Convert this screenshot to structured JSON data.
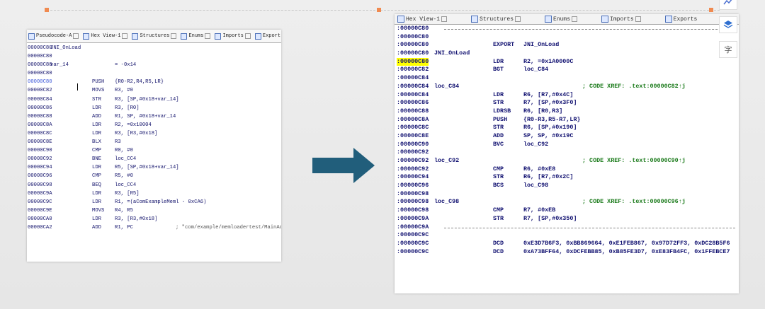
{
  "left": {
    "tabs": [
      "Pseudocode-A",
      "Hex View-1",
      "Structures",
      "Enums",
      "Imports",
      "Export"
    ],
    "lines": [
      {
        "addr": "00000C80",
        "label": "JNI_OnLoad",
        "mn": "",
        "op": "",
        "cm": ""
      },
      {
        "addr": "00000C80",
        "label": "",
        "mn": "",
        "op": "",
        "cm": ""
      },
      {
        "addr": "00000C80",
        "label": "var_14",
        "mn": "",
        "op": "= -0x14",
        "cm": ""
      },
      {
        "addr": "00000C80",
        "label": "",
        "mn": "",
        "op": "",
        "cm": ""
      },
      {
        "addr": "00000C80",
        "label": "",
        "mn": "PUSH",
        "op": "{R0-R2,R4,R5,LR}",
        "cm": "",
        "hl": true
      },
      {
        "addr": "00000C82",
        "label": "",
        "mn": "MOVS",
        "op": "R3, #0",
        "cm": ""
      },
      {
        "addr": "00000C84",
        "label": "",
        "mn": "STR",
        "op": "R3, [SP,#0x18+var_14]",
        "cm": ""
      },
      {
        "addr": "00000C86",
        "label": "",
        "mn": "LDR",
        "op": "R3, [R0]",
        "cm": ""
      },
      {
        "addr": "00000C88",
        "label": "",
        "mn": "ADD",
        "op": "R1, SP, #0x18+var_14",
        "cm": ""
      },
      {
        "addr": "00000C8A",
        "label": "",
        "mn": "LDR",
        "op": "R2, =0x10004",
        "cm": ""
      },
      {
        "addr": "00000C8C",
        "label": "",
        "mn": "LDR",
        "op": "R3, [R3,#0x18]",
        "cm": ""
      },
      {
        "addr": "00000C8E",
        "label": "",
        "mn": "BLX",
        "op": "R3",
        "cm": ""
      },
      {
        "addr": "00000C90",
        "label": "",
        "mn": "CMP",
        "op": "R0, #0",
        "cm": ""
      },
      {
        "addr": "00000C92",
        "label": "",
        "mn": "BNE",
        "op": "loc_CC4",
        "cm": ""
      },
      {
        "addr": "00000C94",
        "label": "",
        "mn": "LDR",
        "op": "R5, [SP,#0x18+var_14]",
        "cm": ""
      },
      {
        "addr": "00000C96",
        "label": "",
        "mn": "CMP",
        "op": "R5, #0",
        "cm": ""
      },
      {
        "addr": "00000C98",
        "label": "",
        "mn": "BEQ",
        "op": "loc_CC4",
        "cm": ""
      },
      {
        "addr": "00000C9A",
        "label": "",
        "mn": "LDR",
        "op": "R3, [R5]",
        "cm": ""
      },
      {
        "addr": "00000C9C",
        "label": "",
        "mn": "LDR",
        "op": "R1, =(aComExampleMeml - 0xCA6)",
        "cm": ""
      },
      {
        "addr": "00000C9E",
        "label": "",
        "mn": "MOVS",
        "op": "R4, R5",
        "cm": ""
      },
      {
        "addr": "00000CA0",
        "label": "",
        "mn": "LDR",
        "op": "R3, [R3,#0x18]",
        "cm": ""
      },
      {
        "addr": "00000CA2",
        "label": "",
        "mn": "ADD",
        "op": "R1, PC",
        "cm": "; \"com/example/memloadertest/MainActivity\""
      }
    ]
  },
  "right": {
    "tabs": [
      "Hex View-1",
      "Structures",
      "Enums",
      "Imports",
      "Exports"
    ],
    "lines": [
      {
        "addr": ":00000C80",
        "label": "",
        "mn": "",
        "op": "",
        "cm": "",
        "sep": true
      },
      {
        "addr": ":00000C80",
        "label": "",
        "mn": "",
        "op": "",
        "cm": ""
      },
      {
        "addr": ":00000C80",
        "label": "",
        "mn": "EXPORT",
        "op": "JNI_OnLoad",
        "cm": ""
      },
      {
        "addr": ":00000C80",
        "label": "JNI_OnLoad",
        "mn": "",
        "op": "",
        "cm": ""
      },
      {
        "addr": ":00000C80",
        "label": "",
        "mn": "LDR",
        "op": "R2, =0x1A0000C",
        "cm": "",
        "hl": true
      },
      {
        "addr": ":00000C82",
        "label": "",
        "mn": "BGT",
        "op": "loc_C84",
        "cm": ""
      },
      {
        "addr": ":00000C84",
        "label": "",
        "mn": "",
        "op": "",
        "cm": ""
      },
      {
        "addr": ":00000C84",
        "label": "loc_C84",
        "mn": "",
        "op": "",
        "cm": "; CODE XREF: .text:00000C82↑j"
      },
      {
        "addr": ":00000C84",
        "label": "",
        "mn": "LDR",
        "op": "R6, [R7,#0x4C]",
        "cm": ""
      },
      {
        "addr": ":00000C86",
        "label": "",
        "mn": "STR",
        "op": "R7, [SP,#0x3F0]",
        "cm": ""
      },
      {
        "addr": ":00000C88",
        "label": "",
        "mn": "LDRSB",
        "op": "R6, [R0,R3]",
        "cm": ""
      },
      {
        "addr": ":00000C8A",
        "label": "",
        "mn": "PUSH",
        "op": "{R0-R3,R5-R7,LR}",
        "cm": ""
      },
      {
        "addr": ":00000C8C",
        "label": "",
        "mn": "STR",
        "op": "R6, [SP,#0x190]",
        "cm": ""
      },
      {
        "addr": ":00000C8E",
        "label": "",
        "mn": "ADD",
        "op": "SP, SP, #0x19C",
        "cm": ""
      },
      {
        "addr": ":00000C90",
        "label": "",
        "mn": "BVC",
        "op": "loc_C92",
        "cm": ""
      },
      {
        "addr": ":00000C92",
        "label": "",
        "mn": "",
        "op": "",
        "cm": ""
      },
      {
        "addr": ":00000C92",
        "label": "loc_C92",
        "mn": "",
        "op": "",
        "cm": "; CODE XREF: .text:00000C90↑j"
      },
      {
        "addr": ":00000C92",
        "label": "",
        "mn": "CMP",
        "op": "R6, #0xE8",
        "cm": ""
      },
      {
        "addr": ":00000C94",
        "label": "",
        "mn": "STR",
        "op": "R6, [R7,#0x2C]",
        "cm": ""
      },
      {
        "addr": ":00000C96",
        "label": "",
        "mn": "BCS",
        "op": "loc_C98",
        "cm": ""
      },
      {
        "addr": ":00000C98",
        "label": "",
        "mn": "",
        "op": "",
        "cm": ""
      },
      {
        "addr": ":00000C98",
        "label": "loc_C98",
        "mn": "",
        "op": "",
        "cm": "; CODE XREF: .text:00000C96↑j"
      },
      {
        "addr": ":00000C98",
        "label": "",
        "mn": "CMP",
        "op": "R7, #0xEB",
        "cm": ""
      },
      {
        "addr": ":00000C9A",
        "label": "",
        "mn": "STR",
        "op": "R7, [SP,#0x350]",
        "cm": ""
      },
      {
        "addr": ":00000C9A",
        "label": "",
        "mn": "",
        "op": "",
        "cm": "",
        "sep": true
      },
      {
        "addr": ":00000C9C",
        "label": "",
        "mn": "",
        "op": "",
        "cm": ""
      },
      {
        "addr": ":00000C9C",
        "label": "",
        "mn": "DCD",
        "op": "0xE3D7B6F3, 0xBB869664, 0xE1FEB867, 0x97D72FF3, 0xDC28B5F6",
        "cm": ""
      },
      {
        "addr": ":00000C9C",
        "label": "",
        "mn": "DCD",
        "op": "0xA73BFF64, 0xDCFEBB85, 0xB85FE3D7, 0xE83FB4FC, 0x1FFEBCE7",
        "cm": ""
      }
    ]
  },
  "tools": {
    "icons": [
      "chart-icon",
      "layers-icon",
      "text-icon"
    ],
    "text_glyph": "字"
  },
  "colors": {
    "arrow": "#215e7b",
    "handle": "#f08a50",
    "highlight": "#ffff00"
  }
}
